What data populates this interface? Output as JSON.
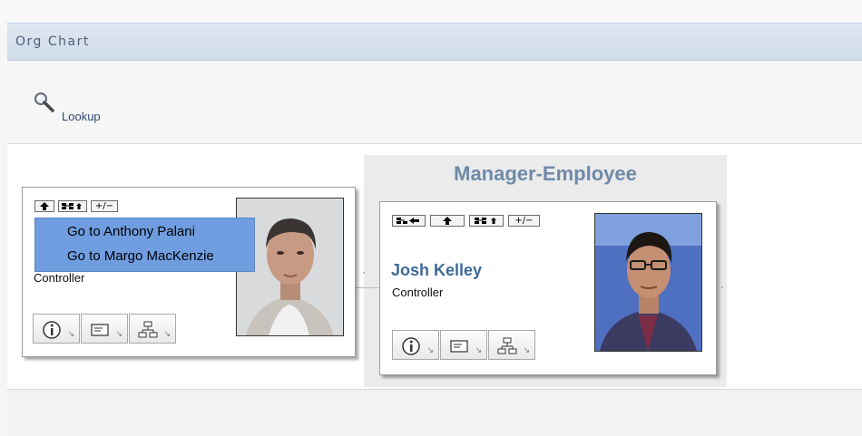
{
  "header": {
    "title": "Org Chart"
  },
  "toolbar": {
    "lookup_label": "Lookup",
    "lookup_icon": "magnifier-icon"
  },
  "focus_panel": {
    "title": "Manager-Employee"
  },
  "card_left": {
    "title": "Controller",
    "toolbar": {
      "up_icon": "up-arrow-icon",
      "children_icon": "show-reports-icon",
      "toggle_label": "+/−"
    },
    "actions": [
      "info-icon",
      "card-icon",
      "org-icon"
    ]
  },
  "popup_menu": {
    "items": [
      "Go to Anthony Palani",
      "Go to Margo MacKenzie"
    ]
  },
  "card_right": {
    "name": "Josh Kelley",
    "title": "Controller",
    "toolbar": {
      "restore_icon": "restore-icon",
      "up_icon": "up-arrow-icon",
      "children_icon": "show-reports-icon",
      "toggle_label": "+/−"
    },
    "actions": [
      "info-icon",
      "card-icon",
      "org-icon"
    ]
  },
  "colors": {
    "accent": "#6f8aa8",
    "link": "#2e4a6f",
    "menu_highlight": "#6f9de0",
    "name_text": "#3f6a9a"
  }
}
